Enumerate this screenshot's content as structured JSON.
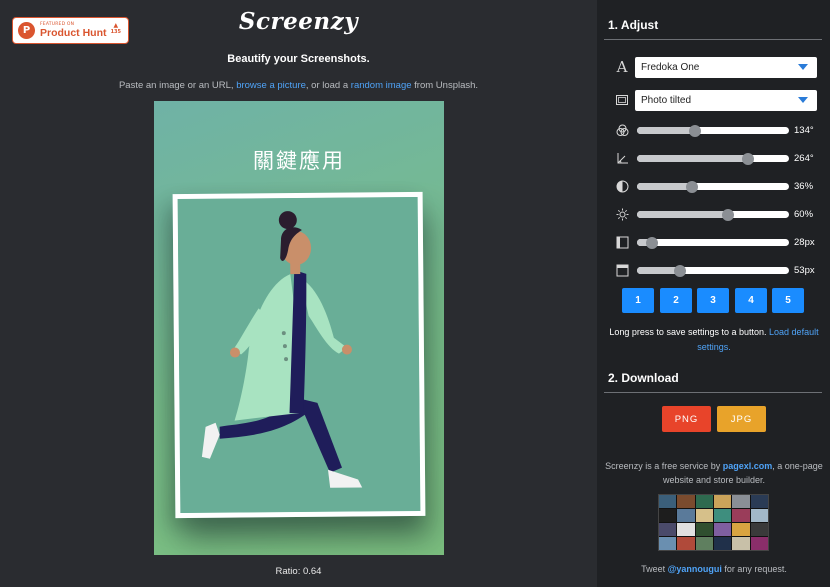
{
  "badge": {
    "featured_on": "FEATURED ON",
    "name": "Product Hunt",
    "arrow": "▲",
    "votes": "135"
  },
  "header": {
    "logo": "Screenzy",
    "tagline": "Beautify your Screenshots.",
    "instr_prefix": "Paste an image or an URL,",
    "browse_link": "browse a picture",
    "instr_mid": ", or load a",
    "random_link": "random image",
    "instr_suffix": "from Unsplash."
  },
  "canvas": {
    "title": "關鍵應用",
    "ratio": "Ratio: 0.64"
  },
  "adjust": {
    "title": "1. Adjust",
    "font_select": "Fredoka One",
    "frame_select": "Photo tilted",
    "sliders": [
      {
        "icon": "color-wheel-icon",
        "value": "134°",
        "percent": 38
      },
      {
        "icon": "angle-icon",
        "value": "264°",
        "percent": 73
      },
      {
        "icon": "contrast-icon",
        "value": "36%",
        "percent": 36
      },
      {
        "icon": "brightness-icon",
        "value": "60%",
        "percent": 60
      },
      {
        "icon": "padding-x-icon",
        "value": "28px",
        "percent": 10
      },
      {
        "icon": "padding-y-icon",
        "value": "53px",
        "percent": 28
      }
    ],
    "presets": [
      "1",
      "2",
      "3",
      "4",
      "5"
    ],
    "hint_text": "Long press to save settings to a button.",
    "hint_link": "Load default settings."
  },
  "download": {
    "title": "2. Download",
    "png_label": "PNG",
    "jpg_label": "JPG",
    "png_color": "#e8442a",
    "jpg_color": "#e8a32a"
  },
  "footer": {
    "text_prefix": "Screenzy is a free service by",
    "link": "pagexl.com",
    "text_suffix": ", a one-page website and store builder.",
    "tweet_prefix": "Tweet",
    "tweet_handle": "@yannougui",
    "tweet_suffix": "for any request."
  },
  "colors": {
    "accent": "#1a8cff",
    "link": "#4fa3f7",
    "sidebar_bg": "#1f2124",
    "main_bg": "#2a2c30"
  }
}
